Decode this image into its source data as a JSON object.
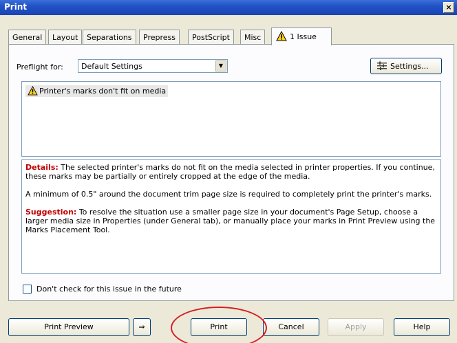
{
  "window": {
    "title": "Print",
    "close_glyph": "×"
  },
  "tabs": [
    {
      "label": "General"
    },
    {
      "label": "Layout"
    },
    {
      "label": "Separations"
    },
    {
      "label": "Prepress"
    },
    {
      "label": "PostScript"
    },
    {
      "label": "Misc"
    },
    {
      "label": "1 Issue",
      "icon": "warning-icon"
    }
  ],
  "preflight": {
    "label": "Preflight for:",
    "selected": "Default Settings",
    "settings_button": "Settings..."
  },
  "issues": [
    {
      "text": "Printer's marks don't fit on media",
      "icon": "warning-icon"
    }
  ],
  "details": {
    "details_label": "Details:",
    "details_text": " The selected printer's marks do not fit on the media selected in printer properties. If you continue, these marks may be partially or entirely cropped at the edge of the media.",
    "paragraph2": "A minimum of 0.5\" around the document trim page size is required to completely print the printer's marks.",
    "suggestion_label": "Suggestion:",
    "suggestion_text": " To resolve the situation use a smaller page size in your document's Page Setup, choose a larger media size in Properties (under General tab), or manually place your marks in Print Preview using the Marks Placement Tool."
  },
  "checkbox": {
    "label": "Don't check for this issue in the future",
    "checked": false
  },
  "buttons": {
    "print_preview": "Print Preview",
    "toggle_glyph": "⇒",
    "print": "Print",
    "cancel": "Cancel",
    "apply": "Apply",
    "help": "Help"
  },
  "colors": {
    "titlebar": "#2152c6",
    "keyword": "#c00000",
    "annotation_ring": "#d81c24"
  }
}
